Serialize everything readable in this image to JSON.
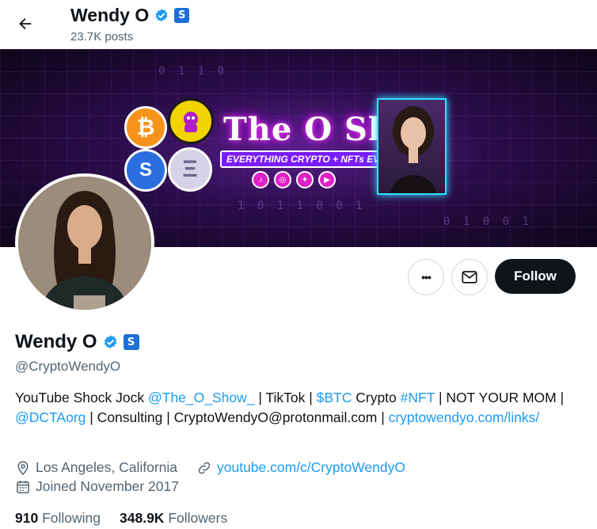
{
  "header": {
    "name": "Wendy O",
    "posts_count": "23.7K posts",
    "org_badge_letter": "S"
  },
  "banner": {
    "show_title": "The O Show",
    "show_subtitle": "EVERYTHING CRYPTO + NFTs EVERYDAY",
    "coins": [
      "₿",
      "S",
      "Ξ"
    ],
    "social_icons": [
      "tiktok-icon",
      "instagram-icon",
      "twitter-icon",
      "youtube-icon"
    ]
  },
  "actions": {
    "more_label": "•••",
    "follow_label": "Follow"
  },
  "profile": {
    "name": "Wendy O",
    "handle": "@CryptoWendyO",
    "org_badge_letter": "S",
    "bio": {
      "t1": "YouTube Shock Jock ",
      "l1": "@The_O_Show_",
      "t2": " | TikTok | ",
      "l2": "$BTC",
      "t3": " Crypto ",
      "l3": "#NFT",
      "t4": " | NOT YOUR MOM | ",
      "l4": "@DCTAorg",
      "t5": " | Consulting | CryptoWendyO@protonmail.com | ",
      "l5": "cryptowendyo.com/links/"
    },
    "location": "Los Angeles, California",
    "website": "youtube.com/c/CryptoWendyO",
    "joined": "Joined November 2017",
    "following_count": "910",
    "following_label": "Following",
    "followers_count": "348.9K",
    "followers_label": "Followers"
  },
  "colors": {
    "link": "#1d9bf0",
    "verified": "#1d9bf0",
    "org_badge": "#1d6fd6",
    "follow_button": "#0f1419"
  }
}
